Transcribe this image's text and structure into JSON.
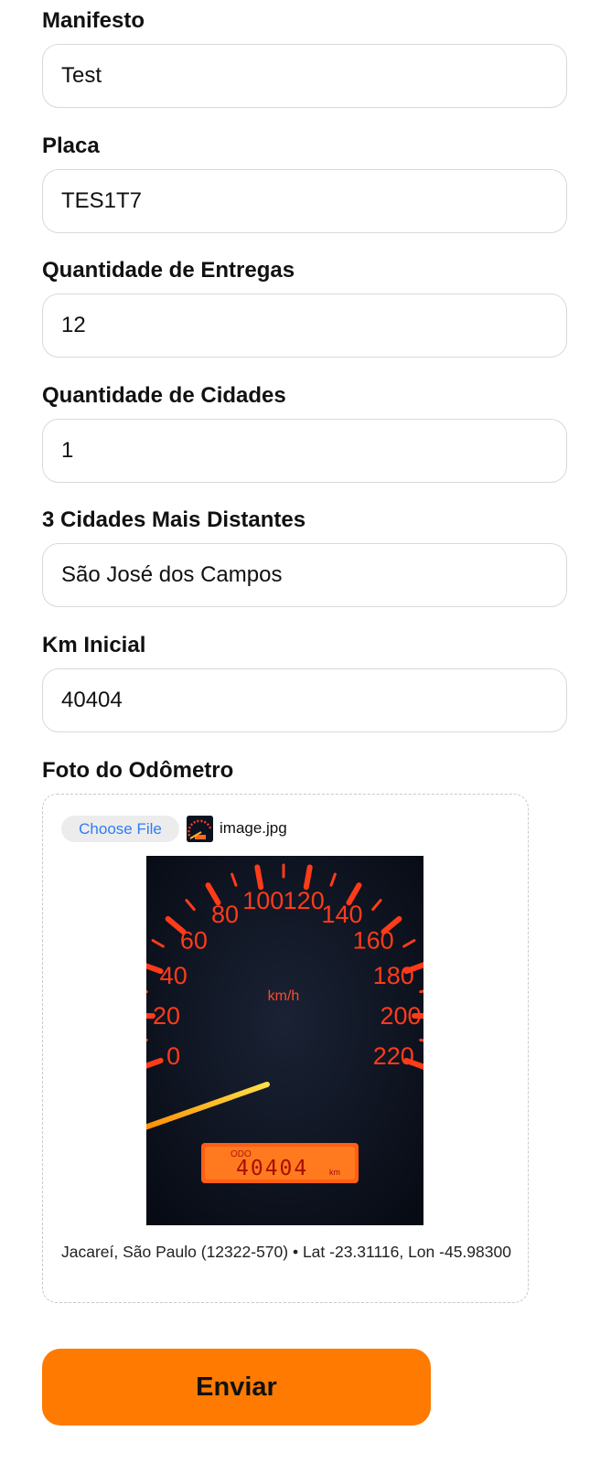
{
  "form": {
    "fields": [
      {
        "label": "Manifesto",
        "value": "Test"
      },
      {
        "label": "Placa",
        "value": "TES1T7"
      },
      {
        "label": "Quantidade de Entregas",
        "value": "12"
      },
      {
        "label": "Quantidade de Cidades",
        "value": "1"
      },
      {
        "label": "3 Cidades Mais Distantes",
        "value": "São José dos Campos"
      },
      {
        "label": "Km Inicial",
        "value": "40404"
      }
    ],
    "photo_label": "Foto do Odômetro",
    "upload": {
      "choose_label": "Choose File",
      "file_name": "image.jpg",
      "photo_icon": "odometer-photo",
      "odometer_reading": "40404",
      "speedometer_unit": "km/h",
      "speedometer_ticks": [
        "0",
        "20",
        "40",
        "60",
        "80",
        "100",
        "120",
        "140",
        "160",
        "180",
        "200",
        "220"
      ],
      "odo_label": "ODO",
      "odo_unit": "km",
      "location_text": "Jacareí, São Paulo (12322-570) • Lat -23.31116, Lon -45.98300"
    },
    "submit_label": "Enviar"
  },
  "colors": {
    "accent": "#ff7a00",
    "link_blue": "#2f7cf6",
    "gauge_red": "#ff3b1a"
  }
}
